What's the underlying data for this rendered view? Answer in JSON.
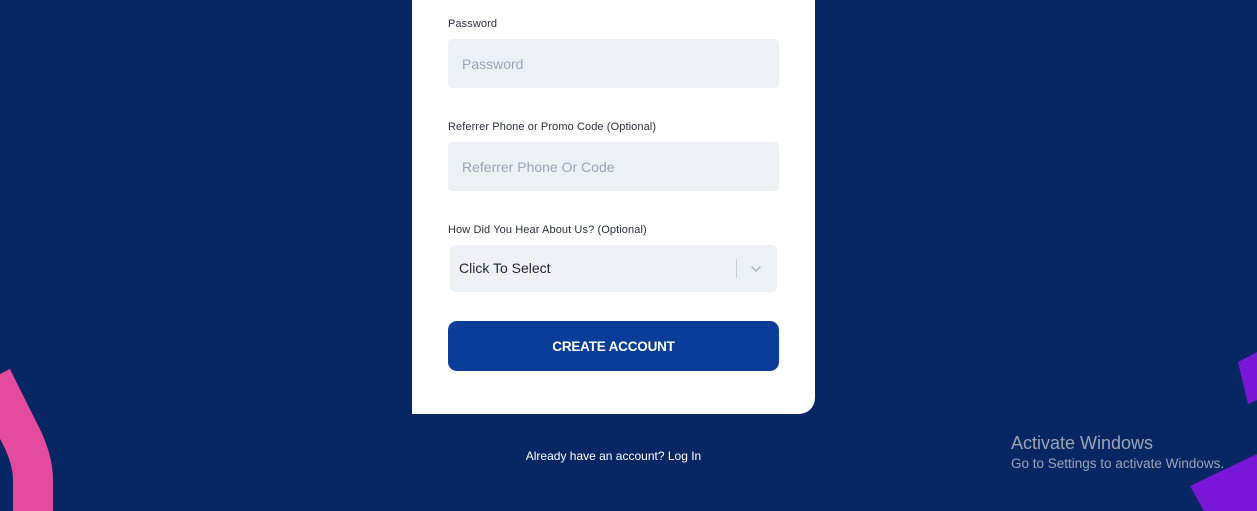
{
  "form": {
    "password": {
      "label": "Password",
      "placeholder": "Password",
      "value": ""
    },
    "referrer": {
      "label": "Referrer Phone or Promo Code (Optional)",
      "placeholder": "Referrer Phone Or Code",
      "value": ""
    },
    "hear_about": {
      "label": "How Did You Hear About Us? (Optional)",
      "selected": "Click To Select"
    },
    "submit_label": "CREATE ACCOUNT"
  },
  "footer": {
    "prompt": "Already have an account?",
    "login_label": "Log In"
  },
  "watermark": {
    "title": "Activate Windows",
    "subtitle": "Go to Settings to activate Windows."
  },
  "colors": {
    "background": "#072764",
    "card": "#ffffff",
    "input_bg": "#edf1f5",
    "primary_button": "#0a3d9a",
    "deco_pink": "#e44b9e",
    "deco_purple": "#7a16d8"
  },
  "icons": {
    "select_chevron": "chevron-down-icon"
  }
}
